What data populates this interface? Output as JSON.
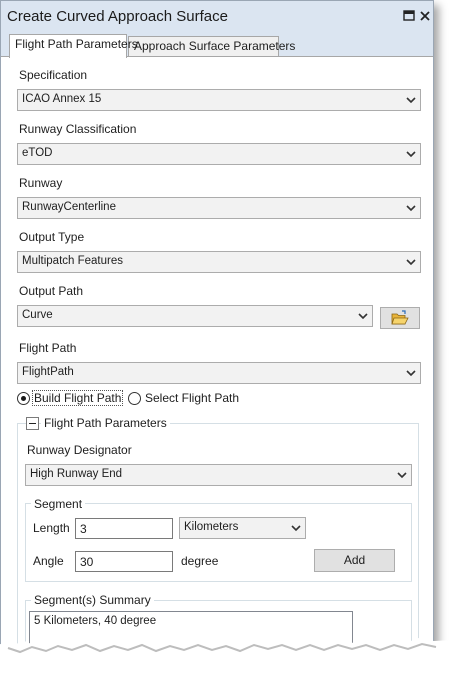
{
  "window": {
    "title": "Create Curved Approach Surface"
  },
  "tabs": [
    {
      "label": "Flight Path Parameters"
    },
    {
      "label": "Approach Surface Parameters"
    }
  ],
  "specification": {
    "label": "Specification",
    "value": "ICAO Annex 15"
  },
  "runway_classification": {
    "label": "Runway Classification",
    "value": "eTOD"
  },
  "runway": {
    "label": "Runway",
    "value": "RunwayCenterline"
  },
  "output_type": {
    "label": "Output Type",
    "value": "Multipatch Features"
  },
  "output_path": {
    "label": "Output Path",
    "value": "Curve"
  },
  "flight_path": {
    "label": "Flight Path",
    "value": "FlightPath"
  },
  "radios": {
    "build": {
      "label": "Build Flight Path",
      "selected": true
    },
    "select": {
      "label": "Select Flight Path",
      "selected": false
    }
  },
  "flight_path_parameters": {
    "title": "Flight Path Parameters",
    "runway_designator": {
      "label": "Runway Designator",
      "value": "High Runway End"
    },
    "segment": {
      "title": "Segment",
      "length_label": "Length",
      "length_value": "3",
      "length_unit": "Kilometers",
      "angle_label": "Angle",
      "angle_value": "30",
      "angle_unit": "degree",
      "add_label": "Add"
    },
    "summary": {
      "title": "Segment(s) Summary",
      "items": [
        "5 Kilometers, 40 degree"
      ]
    }
  },
  "icons": {
    "pin": "pin-icon",
    "close": "close-icon",
    "dropdown": "chevron-down-icon",
    "browse": "open-folder-icon"
  },
  "colors": {
    "titlebar": "#dbe5f1",
    "folder": "#f0c24a"
  }
}
